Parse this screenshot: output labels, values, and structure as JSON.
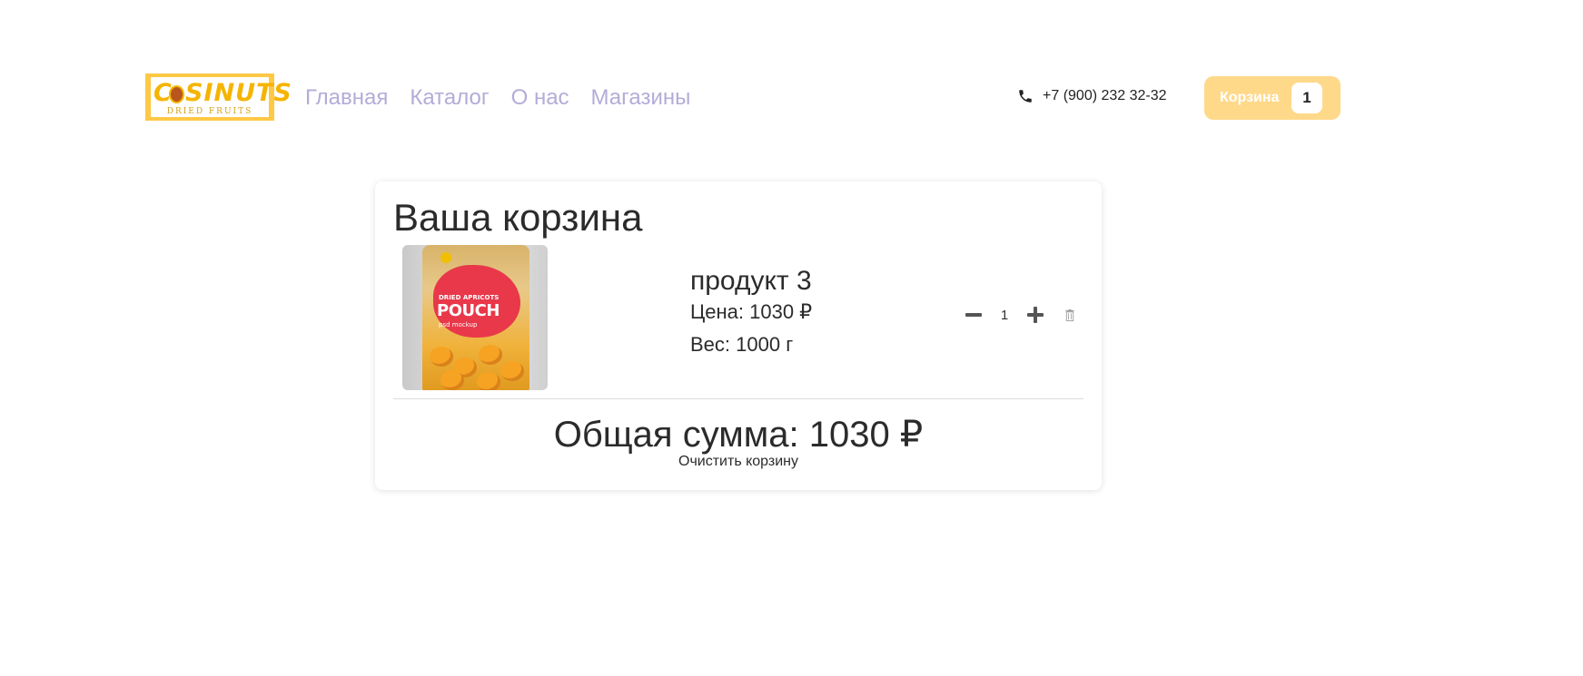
{
  "brand": {
    "logo_letter": "C",
    "logo_word": "SINUTS",
    "logo_sub": "DRIED FRUITS"
  },
  "nav": {
    "items": [
      {
        "label": "Главная"
      },
      {
        "label": "Каталог"
      },
      {
        "label": "О нас"
      },
      {
        "label": "Магазины"
      }
    ]
  },
  "contact": {
    "phone": "+7 (900) 232 32-32",
    "icon": "phone-icon"
  },
  "cart_button": {
    "label": "Корзина",
    "count": "1"
  },
  "cart": {
    "title": "Ваша корзина",
    "items": [
      {
        "name": "продукт 3",
        "price": "Цена: 1030 ₽",
        "weight": "Вес: 1000 г",
        "quantity": "1",
        "image": {
          "label_top": "DRIED APRICOTS",
          "label_main": "POUCH",
          "label_sub": "psd mockup"
        }
      }
    ],
    "total": "Общая сумма: 1030 ₽",
    "clear_label": "Очистить корзину"
  },
  "colors": {
    "accent": "#ffc845",
    "nav_link": "#b3acd8",
    "cart_button_bg": "#ffd98a"
  }
}
